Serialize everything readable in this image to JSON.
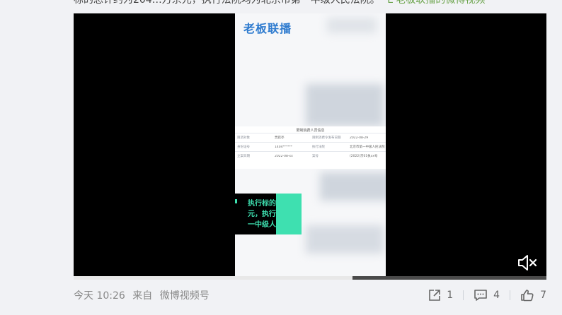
{
  "post": {
    "body_text_fragment": "标的总计约为204…万余元，执行法院均为北京市第一中级人民法院。",
    "video_link": "L 老板联播的微博视频"
  },
  "video": {
    "logo_text": "老板联播",
    "document": {
      "title": "限制消费人员信息",
      "rows": [
        [
          "限消对象",
          "贾跃亭",
          "限制消费令发布日期",
          "2022-08-29"
        ],
        [
          "身份证号",
          "1404******",
          "执行法院",
          "北京市第一中级人民法院"
        ],
        [
          "立案日期",
          "2022-08-xx",
          "案号",
          "(2022)京01执xx号"
        ]
      ]
    },
    "subtitle_lines": [
      "执行标的",
      "元，执行",
      "一中级人"
    ],
    "progress": 0.59,
    "muted": true
  },
  "footer": {
    "time": "今天 10:26",
    "source_prefix": "来自",
    "source": "微博视频号",
    "repost_count": "1",
    "comment_count": "4",
    "like_count": "7"
  },
  "icons": {
    "mute": "speaker-muted-icon",
    "repost": "share-out-icon",
    "comment": "comment-icon",
    "like": "thumbs-up-icon"
  },
  "colors": {
    "background": "#f1f2f5",
    "link_green": "#6aa34a",
    "subtitle_green": "#3ee0b0",
    "logo_blue": "#2e7bcf"
  }
}
